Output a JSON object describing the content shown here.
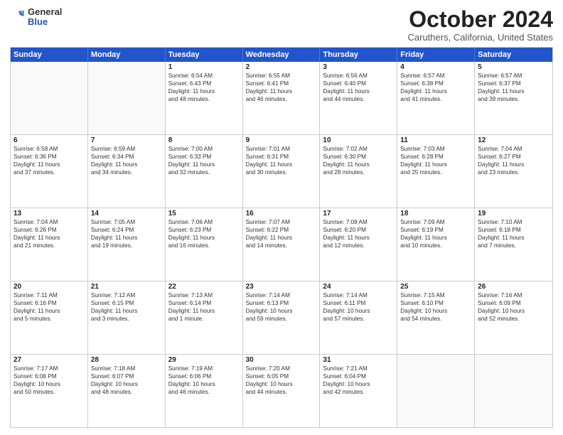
{
  "logo": {
    "text_general": "General",
    "text_blue": "Blue"
  },
  "title": "October 2024",
  "location": "Caruthers, California, United States",
  "header_days": [
    "Sunday",
    "Monday",
    "Tuesday",
    "Wednesday",
    "Thursday",
    "Friday",
    "Saturday"
  ],
  "weeks": [
    [
      {
        "day": "",
        "lines": []
      },
      {
        "day": "",
        "lines": []
      },
      {
        "day": "1",
        "lines": [
          "Sunrise: 6:54 AM",
          "Sunset: 6:43 PM",
          "Daylight: 11 hours",
          "and 48 minutes."
        ]
      },
      {
        "day": "2",
        "lines": [
          "Sunrise: 6:55 AM",
          "Sunset: 6:41 PM",
          "Daylight: 11 hours",
          "and 46 minutes."
        ]
      },
      {
        "day": "3",
        "lines": [
          "Sunrise: 6:56 AM",
          "Sunset: 6:40 PM",
          "Daylight: 11 hours",
          "and 44 minutes."
        ]
      },
      {
        "day": "4",
        "lines": [
          "Sunrise: 6:57 AM",
          "Sunset: 6:38 PM",
          "Daylight: 11 hours",
          "and 41 minutes."
        ]
      },
      {
        "day": "5",
        "lines": [
          "Sunrise: 6:57 AM",
          "Sunset: 6:37 PM",
          "Daylight: 11 hours",
          "and 39 minutes."
        ]
      }
    ],
    [
      {
        "day": "6",
        "lines": [
          "Sunrise: 6:58 AM",
          "Sunset: 6:36 PM",
          "Daylight: 11 hours",
          "and 37 minutes."
        ]
      },
      {
        "day": "7",
        "lines": [
          "Sunrise: 6:59 AM",
          "Sunset: 6:34 PM",
          "Daylight: 11 hours",
          "and 34 minutes."
        ]
      },
      {
        "day": "8",
        "lines": [
          "Sunrise: 7:00 AM",
          "Sunset: 6:33 PM",
          "Daylight: 11 hours",
          "and 32 minutes."
        ]
      },
      {
        "day": "9",
        "lines": [
          "Sunrise: 7:01 AM",
          "Sunset: 6:31 PM",
          "Daylight: 11 hours",
          "and 30 minutes."
        ]
      },
      {
        "day": "10",
        "lines": [
          "Sunrise: 7:02 AM",
          "Sunset: 6:30 PM",
          "Daylight: 11 hours",
          "and 28 minutes."
        ]
      },
      {
        "day": "11",
        "lines": [
          "Sunrise: 7:03 AM",
          "Sunset: 6:28 PM",
          "Daylight: 11 hours",
          "and 25 minutes."
        ]
      },
      {
        "day": "12",
        "lines": [
          "Sunrise: 7:04 AM",
          "Sunset: 6:27 PM",
          "Daylight: 11 hours",
          "and 23 minutes."
        ]
      }
    ],
    [
      {
        "day": "13",
        "lines": [
          "Sunrise: 7:04 AM",
          "Sunset: 6:26 PM",
          "Daylight: 11 hours",
          "and 21 minutes."
        ]
      },
      {
        "day": "14",
        "lines": [
          "Sunrise: 7:05 AM",
          "Sunset: 6:24 PM",
          "Daylight: 11 hours",
          "and 19 minutes."
        ]
      },
      {
        "day": "15",
        "lines": [
          "Sunrise: 7:06 AM",
          "Sunset: 6:23 PM",
          "Daylight: 11 hours",
          "and 16 minutes."
        ]
      },
      {
        "day": "16",
        "lines": [
          "Sunrise: 7:07 AM",
          "Sunset: 6:22 PM",
          "Daylight: 11 hours",
          "and 14 minutes."
        ]
      },
      {
        "day": "17",
        "lines": [
          "Sunrise: 7:08 AM",
          "Sunset: 6:20 PM",
          "Daylight: 11 hours",
          "and 12 minutes."
        ]
      },
      {
        "day": "18",
        "lines": [
          "Sunrise: 7:09 AM",
          "Sunset: 6:19 PM",
          "Daylight: 11 hours",
          "and 10 minutes."
        ]
      },
      {
        "day": "19",
        "lines": [
          "Sunrise: 7:10 AM",
          "Sunset: 6:18 PM",
          "Daylight: 11 hours",
          "and 7 minutes."
        ]
      }
    ],
    [
      {
        "day": "20",
        "lines": [
          "Sunrise: 7:11 AM",
          "Sunset: 6:16 PM",
          "Daylight: 11 hours",
          "and 5 minutes."
        ]
      },
      {
        "day": "21",
        "lines": [
          "Sunrise: 7:12 AM",
          "Sunset: 6:15 PM",
          "Daylight: 11 hours",
          "and 3 minutes."
        ]
      },
      {
        "day": "22",
        "lines": [
          "Sunrise: 7:13 AM",
          "Sunset: 6:14 PM",
          "Daylight: 11 hours",
          "and 1 minute."
        ]
      },
      {
        "day": "23",
        "lines": [
          "Sunrise: 7:14 AM",
          "Sunset: 6:13 PM",
          "Daylight: 10 hours",
          "and 59 minutes."
        ]
      },
      {
        "day": "24",
        "lines": [
          "Sunrise: 7:14 AM",
          "Sunset: 6:11 PM",
          "Daylight: 10 hours",
          "and 57 minutes."
        ]
      },
      {
        "day": "25",
        "lines": [
          "Sunrise: 7:15 AM",
          "Sunset: 6:10 PM",
          "Daylight: 10 hours",
          "and 54 minutes."
        ]
      },
      {
        "day": "26",
        "lines": [
          "Sunrise: 7:16 AM",
          "Sunset: 6:09 PM",
          "Daylight: 10 hours",
          "and 52 minutes."
        ]
      }
    ],
    [
      {
        "day": "27",
        "lines": [
          "Sunrise: 7:17 AM",
          "Sunset: 6:08 PM",
          "Daylight: 10 hours",
          "and 50 minutes."
        ]
      },
      {
        "day": "28",
        "lines": [
          "Sunrise: 7:18 AM",
          "Sunset: 6:07 PM",
          "Daylight: 10 hours",
          "and 48 minutes."
        ]
      },
      {
        "day": "29",
        "lines": [
          "Sunrise: 7:19 AM",
          "Sunset: 6:06 PM",
          "Daylight: 10 hours",
          "and 46 minutes."
        ]
      },
      {
        "day": "30",
        "lines": [
          "Sunrise: 7:20 AM",
          "Sunset: 6:05 PM",
          "Daylight: 10 hours",
          "and 44 minutes."
        ]
      },
      {
        "day": "31",
        "lines": [
          "Sunrise: 7:21 AM",
          "Sunset: 6:04 PM",
          "Daylight: 10 hours",
          "and 42 minutes."
        ]
      },
      {
        "day": "",
        "lines": []
      },
      {
        "day": "",
        "lines": []
      }
    ]
  ]
}
